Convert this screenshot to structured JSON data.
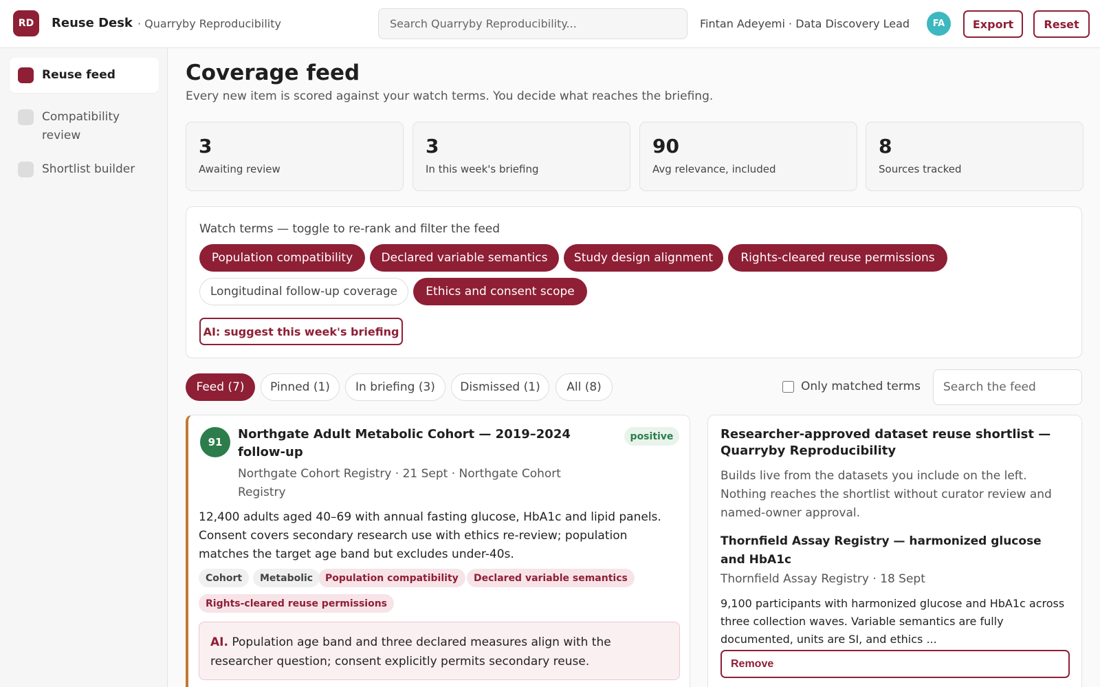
{
  "header": {
    "logo": "RD",
    "app_name": "Reuse Desk",
    "workspace": "· Quarryby Reproducibility",
    "search_placeholder": "Search Quarryby Reproducibility...",
    "user": "Fintan Adeyemi · Data Discovery Lead",
    "avatar": "FA",
    "export_label": "Export",
    "reset_label": "Reset"
  },
  "sidebar": {
    "items": [
      {
        "label": "Reuse feed",
        "active": true
      },
      {
        "label": "Compatibility review",
        "active": false
      },
      {
        "label": "Shortlist builder",
        "active": false
      }
    ]
  },
  "main": {
    "title": "Coverage feed",
    "subtitle": "Every new item is scored against your watch terms. You decide what reaches the briefing."
  },
  "stats": [
    {
      "value": "3",
      "label": "Awaiting review"
    },
    {
      "value": "3",
      "label": "In this week's briefing"
    },
    {
      "value": "90",
      "label": "Avg relevance, included"
    },
    {
      "value": "8",
      "label": "Sources tracked"
    }
  ],
  "watch_terms": {
    "title": "Watch terms — toggle to re-rank and filter the feed",
    "terms": [
      {
        "label": "Population compatibility",
        "on": true
      },
      {
        "label": "Declared variable semantics",
        "on": true
      },
      {
        "label": "Study design alignment",
        "on": true
      },
      {
        "label": "Rights-cleared reuse permissions",
        "on": true
      },
      {
        "label": "Longitudinal follow-up coverage",
        "on": false
      },
      {
        "label": "Ethics and consent scope",
        "on": true
      }
    ],
    "ai_button": "AI: suggest this week's briefing"
  },
  "tabs": [
    {
      "label": "Feed (7)",
      "active": true
    },
    {
      "label": "Pinned (1)",
      "active": false
    },
    {
      "label": "In briefing (3)",
      "active": false
    },
    {
      "label": "Dismissed (1)",
      "active": false
    },
    {
      "label": "All (8)",
      "active": false
    }
  ],
  "filters": {
    "matched_label": "Only matched terms",
    "matched_checked": false,
    "search_placeholder": "Search the feed"
  },
  "feed_item": {
    "score": "91",
    "title": "Northgate Adult Metabolic Cohort — 2019–2024 follow-up",
    "sentiment": "positive",
    "meta": "Northgate Cohort Registry · 21 Sept · Northgate Cohort Registry",
    "body": "12,400 adults aged 40–69 with annual fasting glucose, HbA1c and lipid panels. Consent covers secondary research use with ethics re-review; population matches the target age band but excludes under-40s.",
    "tags": [
      "Cohort",
      "Metabolic"
    ],
    "matched_terms": [
      "Population compatibility",
      "Declared variable semantics",
      "Rights-cleared reuse permissions"
    ],
    "ai_prefix": "AI.",
    "ai_text": "Population age band and three declared measures align with the researcher question; consent explicitly permits secondary reuse."
  },
  "shortlist": {
    "title": "Researcher-approved dataset reuse shortlist — Quarryby Reproducibility",
    "description": "Builds live from the datasets you include on the left. Nothing reaches the shortlist without curator review and named-owner approval.",
    "item_title": "Thornfield Assay Registry — harmonized glucose and HbA1c",
    "item_meta": "Thornfield Assay Registry · 18 Sept",
    "item_body": "9,100 participants with harmonized glucose and HbA1c across three collection waves. Variable semantics are fully documented, units are SI, and ethics ...",
    "remove_label": "Remove"
  },
  "colors": {
    "accent": "#8e1f35",
    "score_green": "#2c7d4b",
    "avatar": "#3db7c0",
    "card_edge": "#c3782f"
  }
}
